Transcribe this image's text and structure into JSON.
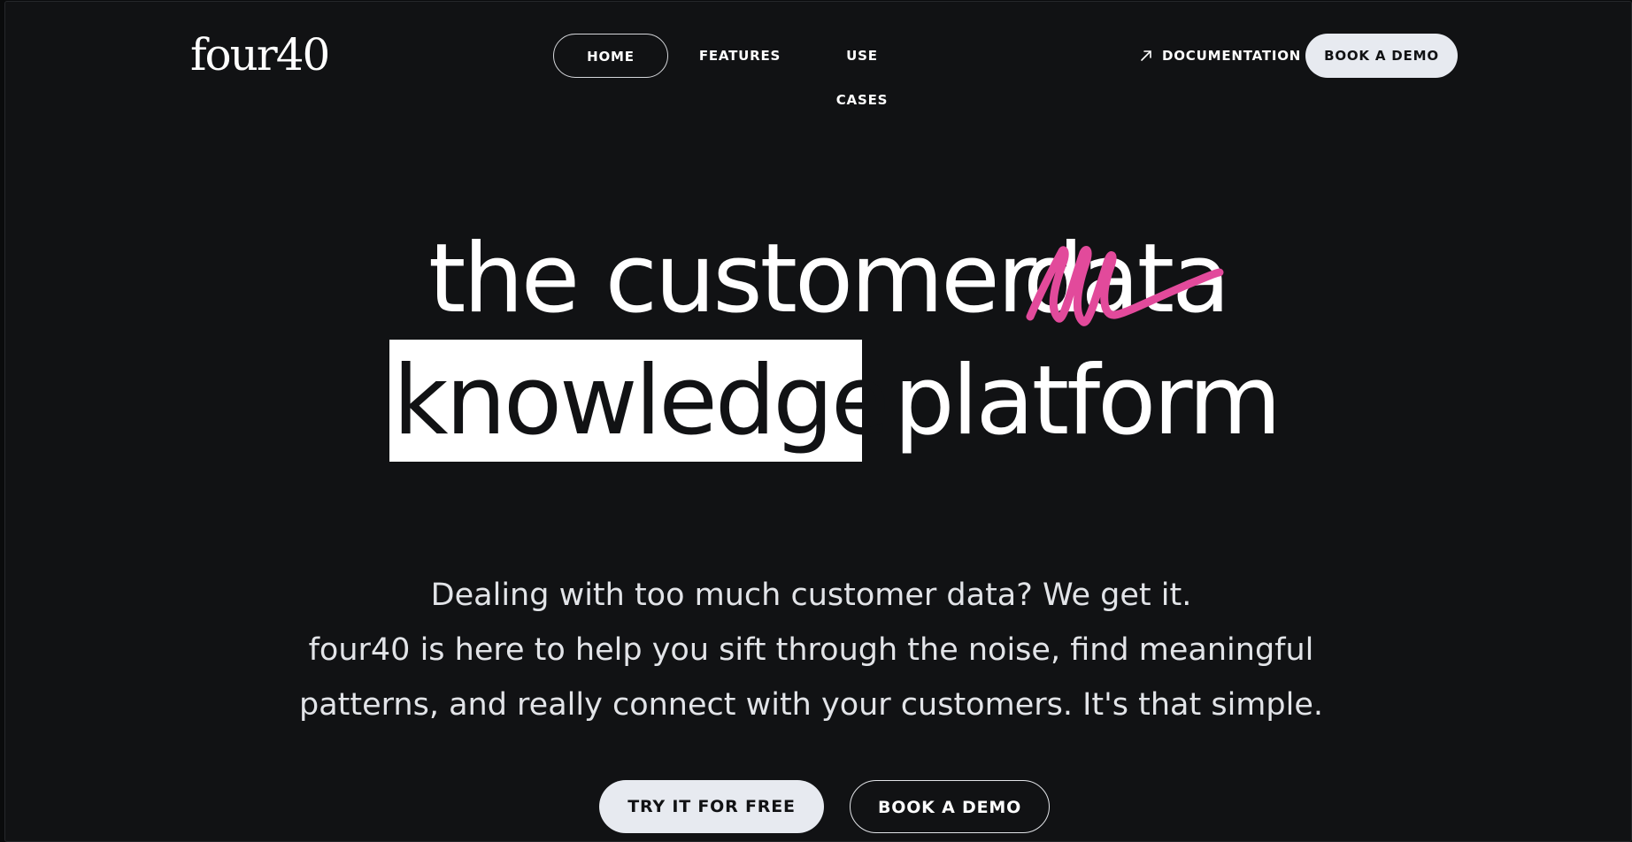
{
  "header": {
    "logo": "four40",
    "nav": [
      {
        "label": "HOME",
        "active": true
      },
      {
        "label": "FEATURES",
        "active": false
      },
      {
        "label": "USE CASES",
        "active": false
      }
    ],
    "documentation_label": "DOCUMENTATION",
    "documentation_icon": "arrow-up-right-icon",
    "book_demo_label": "BOOK A DEMO"
  },
  "hero": {
    "line1_prefix": "the customer",
    "struck_word": "data",
    "highlighted_word": "knowledge",
    "line2_suffix": "platform",
    "scribble_color": "#e24a9b"
  },
  "subcopy": {
    "line1": "Dealing with too much customer data? We get it.",
    "line2": "four40 is here to help you sift through the noise, find meaningful",
    "line3": "patterns, and really connect with your customers. It's that simple."
  },
  "cta": {
    "primary": "TRY IT FOR FREE",
    "secondary": "BOOK A DEMO"
  },
  "colors": {
    "background": "#111214",
    "text": "#ffffff",
    "button_light": "#e7eaf0",
    "accent": "#e24a9b"
  }
}
